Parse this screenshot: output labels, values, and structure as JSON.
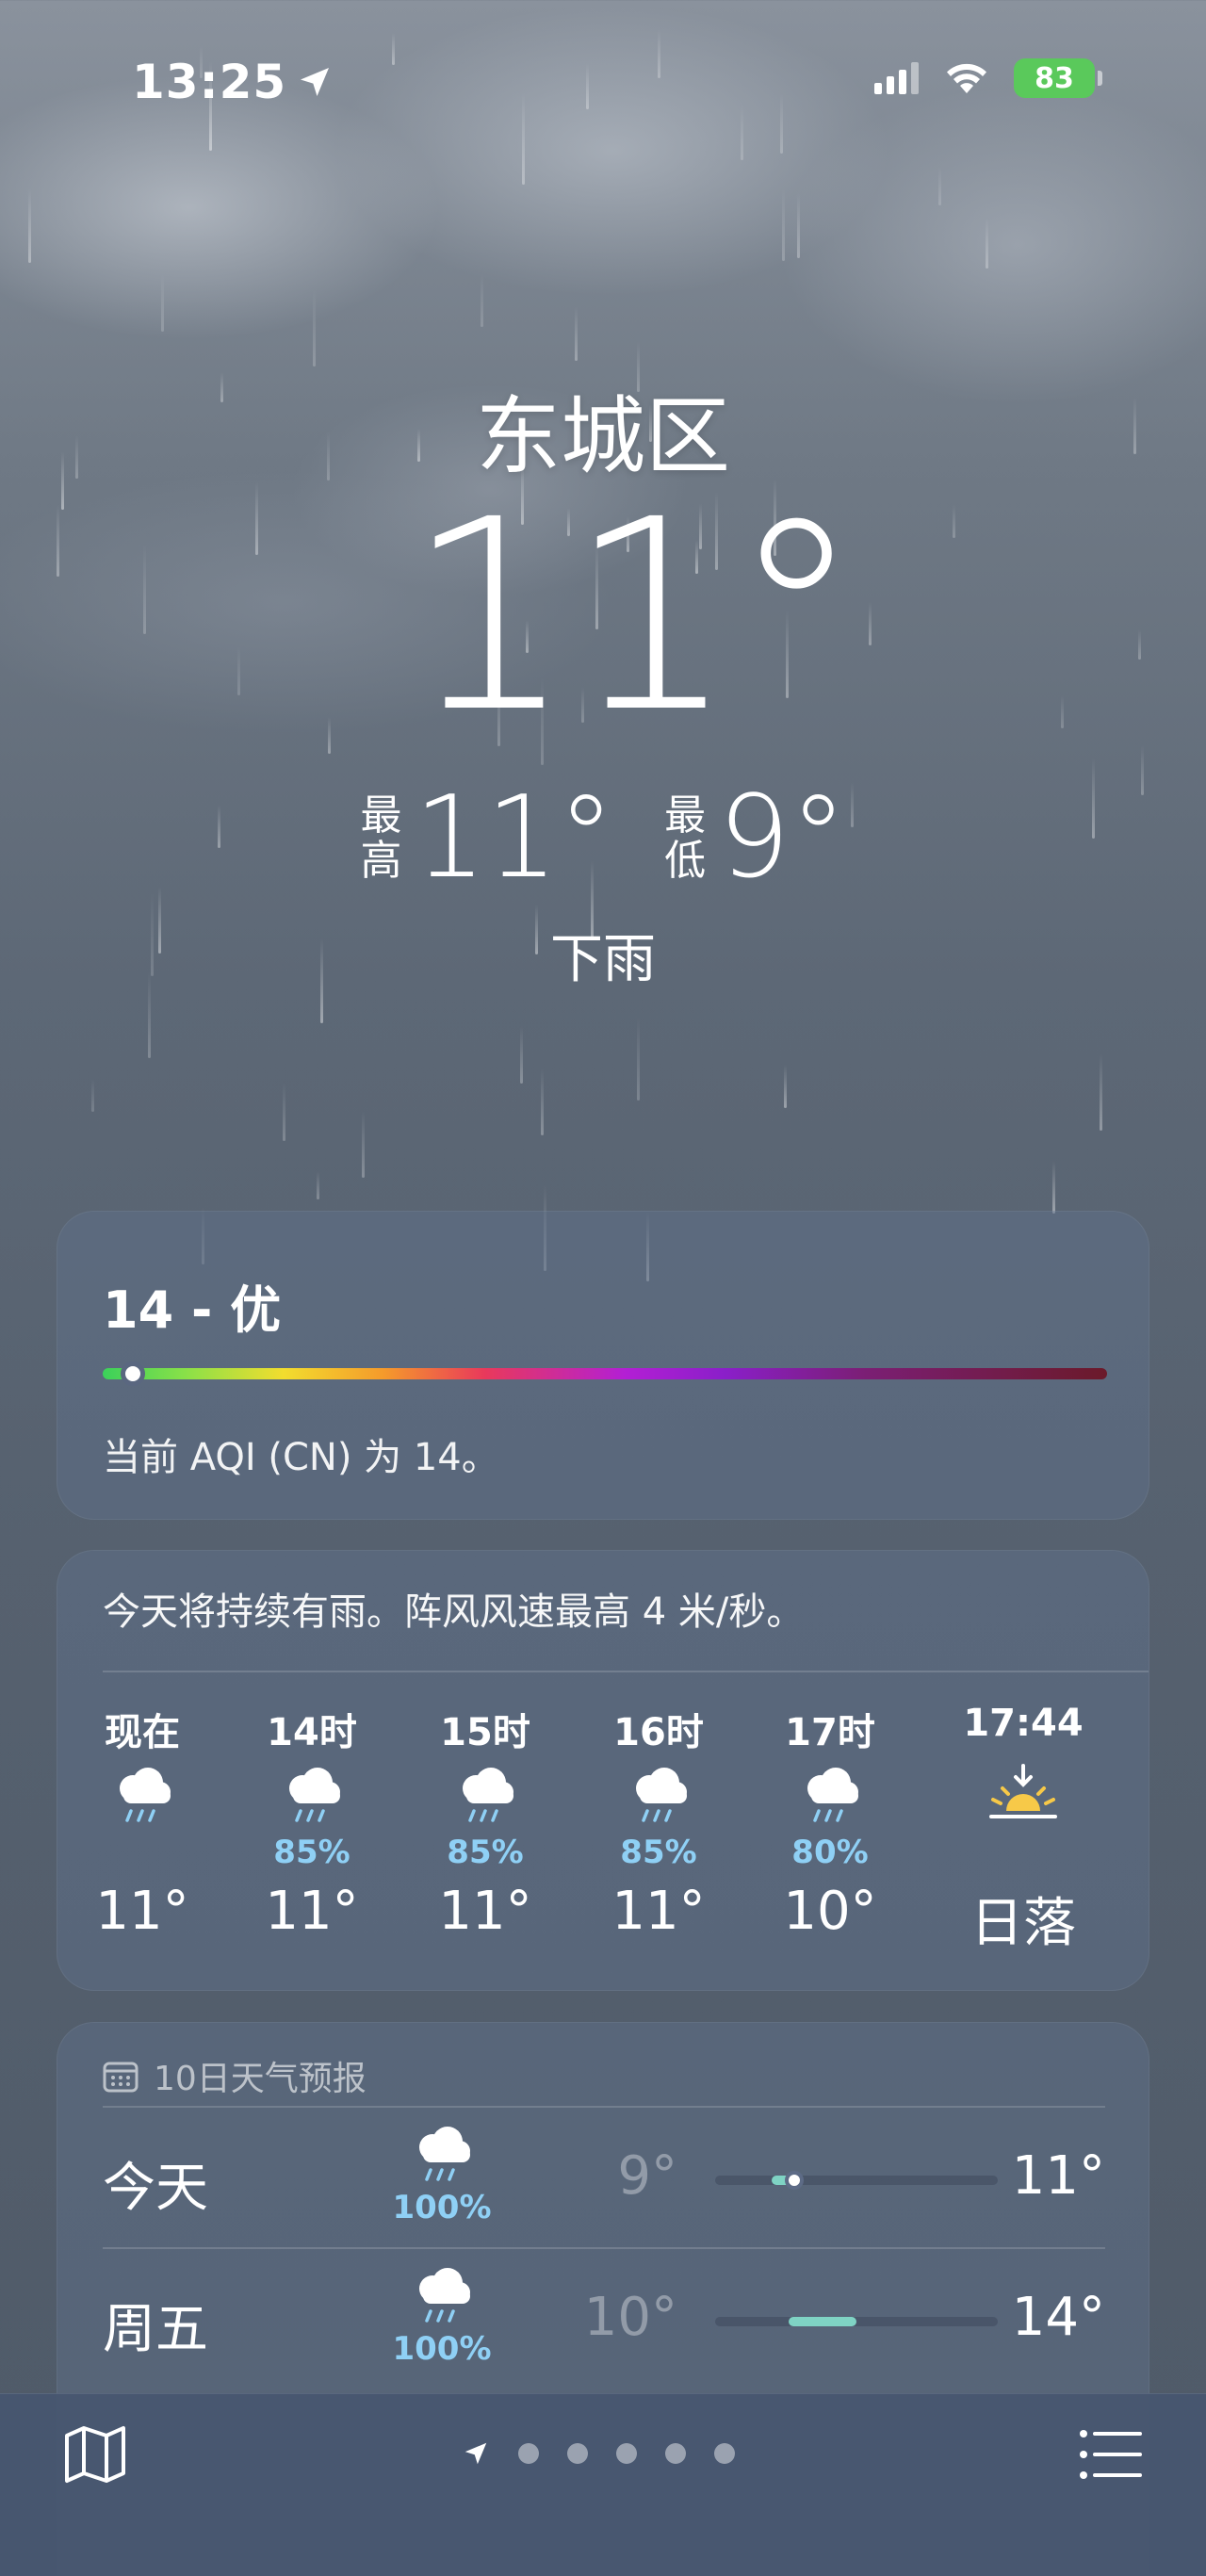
{
  "status_bar": {
    "time": "13:25",
    "battery": "83",
    "battery_color": "#5ac95b",
    "icons": [
      "location-arrow-icon",
      "cellular-signal-icon",
      "wifi-icon",
      "battery-charging-icon"
    ]
  },
  "location": {
    "city": "东城区",
    "current_temp": "11°",
    "high_label": "最高",
    "high": "11°",
    "low_label": "最低",
    "low": "9°",
    "condition": "下雨"
  },
  "aqi": {
    "value_label": "14 - 优",
    "level_fraction": 0.03,
    "description": "当前 AQI (CN) 为 14。"
  },
  "hourly": {
    "summary": "今天将持续有雨。阵风风速最高 4 米/秒。",
    "hours": [
      {
        "label": "现在",
        "icon": "rain-cloud-icon",
        "pop": "",
        "temp": "11°"
      },
      {
        "label": "14时",
        "icon": "rain-cloud-icon",
        "pop": "85%",
        "temp": "11°"
      },
      {
        "label": "15时",
        "icon": "rain-cloud-icon",
        "pop": "85%",
        "temp": "11°"
      },
      {
        "label": "16时",
        "icon": "rain-cloud-icon",
        "pop": "85%",
        "temp": "11°"
      },
      {
        "label": "17时",
        "icon": "rain-cloud-icon",
        "pop": "80%",
        "temp": "10°"
      },
      {
        "label": "17:44",
        "icon": "sunset-icon",
        "pop": "",
        "temp": "日落"
      }
    ]
  },
  "daily": {
    "title": "10日天气预报",
    "days": [
      {
        "name": "今天",
        "icon": "rain-cloud-icon",
        "pop": "100%",
        "low": "9°",
        "high": "11°",
        "range_start": 0.2,
        "range_end": 0.28,
        "current": 0.28
      },
      {
        "name": "周五",
        "icon": "rain-cloud-icon",
        "pop": "100%",
        "low": "10°",
        "high": "14°",
        "range_start": 0.26,
        "range_end": 0.5
      }
    ]
  },
  "toolbar": {
    "pages": 5,
    "icons": [
      "map-icon",
      "location-arrow-icon",
      "list-icon"
    ]
  }
}
